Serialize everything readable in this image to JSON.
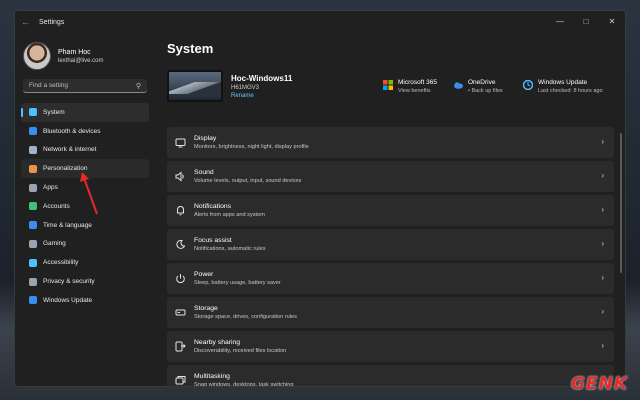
{
  "window": {
    "title": "Settings",
    "back_icon": "arrow-left-icon"
  },
  "profile": {
    "name": "Pham Hoc",
    "email": "lexthai@live.com"
  },
  "search": {
    "placeholder": "Find a setting"
  },
  "sidebar": {
    "items": [
      {
        "label": "System",
        "icon": "monitor-icon",
        "color": "#4cc2ff",
        "active": true
      },
      {
        "label": "Bluetooth & devices",
        "icon": "bluetooth-icon",
        "color": "#3a8ef0"
      },
      {
        "label": "Network & internet",
        "icon": "network-icon",
        "color": "#a0b4c8"
      },
      {
        "label": "Personalization",
        "icon": "brush-icon",
        "color": "#e8954a",
        "hover": true
      },
      {
        "label": "Apps",
        "icon": "apps-icon",
        "color": "#9aa4b0"
      },
      {
        "label": "Accounts",
        "icon": "accounts-icon",
        "color": "#3ec27a"
      },
      {
        "label": "Time & language",
        "icon": "globe-clock-icon",
        "color": "#3a8ef0"
      },
      {
        "label": "Gaming",
        "icon": "gamepad-icon",
        "color": "#9aa4b0"
      },
      {
        "label": "Accessibility",
        "icon": "accessibility-icon",
        "color": "#4cc2ff"
      },
      {
        "label": "Privacy & security",
        "icon": "shield-icon",
        "color": "#9aa4b0"
      },
      {
        "label": "Windows Update",
        "icon": "update-icon",
        "color": "#3a8ef0"
      }
    ]
  },
  "main": {
    "title": "System",
    "device": {
      "name": "Hoc-Windows11",
      "model": "H61MGV3",
      "rename": "Rename"
    },
    "quick": [
      {
        "title": "Microsoft 365",
        "sub": "View benefits",
        "icon": "microsoft-icon"
      },
      {
        "title": "OneDrive",
        "sub": "• Back up files",
        "icon": "cloud-icon"
      },
      {
        "title": "Windows Update",
        "sub": "Last checked: 8 hours ago",
        "icon": "update-icon"
      }
    ],
    "cards": [
      {
        "title": "Display",
        "sub": "Monitors, brightness, night light, display profile",
        "icon": "display-icon"
      },
      {
        "title": "Sound",
        "sub": "Volume levels, output, input, sound devices",
        "icon": "speaker-icon"
      },
      {
        "title": "Notifications",
        "sub": "Alerts from apps and system",
        "icon": "bell-icon"
      },
      {
        "title": "Focus assist",
        "sub": "Notifications, automatic rules",
        "icon": "moon-icon"
      },
      {
        "title": "Power",
        "sub": "Sleep, battery usage, battery saver",
        "icon": "power-icon"
      },
      {
        "title": "Storage",
        "sub": "Storage space, drives, configuration rules",
        "icon": "storage-icon"
      },
      {
        "title": "Nearby sharing",
        "sub": "Discoverability, received files location",
        "icon": "share-icon"
      },
      {
        "title": "Multitasking",
        "sub": "Snap windows, desktops, task switching",
        "icon": "multitask-icon"
      }
    ]
  },
  "watermark": "GENK"
}
